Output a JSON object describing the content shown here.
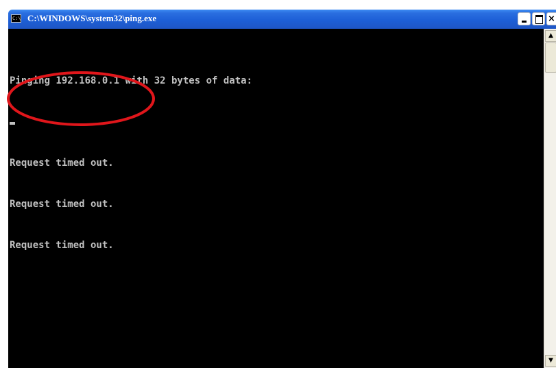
{
  "window": {
    "title": "C:\\WINDOWS\\system32\\ping.exe",
    "icon_label": "C:\\"
  },
  "console": {
    "lines": [
      "",
      "Pinging 192.168.0.1 with 32 bytes of data:",
      "",
      "Request timed out.",
      "Request timed out.",
      "Request timed out."
    ]
  },
  "colors": {
    "titlebar": "#1d5fd6",
    "console_bg": "#000000",
    "console_text": "#c0c0c0",
    "annotation": "#e0161b"
  },
  "icons": {
    "app": "cmd-icon",
    "minimize": "minimize-icon",
    "maximize": "maximize-icon",
    "close": "close-icon",
    "scroll_up": "arrow-up-icon",
    "scroll_down": "arrow-down-icon"
  }
}
